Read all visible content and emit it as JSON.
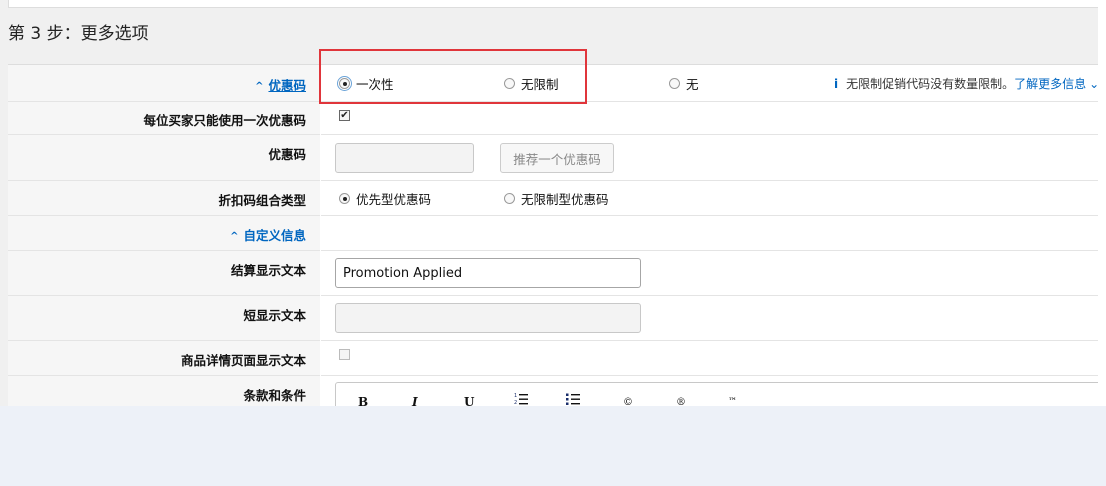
{
  "step_heading": "第 3 步：更多选项",
  "rows": {
    "promo_code_section": {
      "label": "优惠码",
      "options": [
        "一次性",
        "无限制",
        "无"
      ],
      "selected": "一次性"
    },
    "one_per_buyer": {
      "label": "每位买家只能使用一次优惠码",
      "checked": true
    },
    "promo_code_field": {
      "label": "优惠码",
      "value": "",
      "suggest_button": "推荐一个优惠码"
    },
    "combination_type": {
      "label": "折扣码组合类型",
      "options": [
        "优先型优惠码",
        "无限制型优惠码"
      ],
      "selected": "优先型优惠码"
    },
    "custom_info_section": {
      "label": "自定义信息"
    },
    "checkout_text": {
      "label": "结算显示文本",
      "value": "Promotion Applied"
    },
    "short_text": {
      "label": "短显示文本",
      "value": ""
    },
    "detail_page_text": {
      "label": "商品详情页面显示文本",
      "checked": false
    },
    "terms": {
      "label": "条款和条件"
    }
  },
  "info_note": {
    "text": "无限制促销代码没有数量限制。",
    "link": "了解更多信息",
    "link_caret": "⌄",
    "icon": "i"
  },
  "editor_toolbar": [
    "B",
    "I",
    "U",
    "ordered-list",
    "unordered-list",
    "©",
    "®",
    "™"
  ],
  "colors": {
    "link": "#0066c0",
    "highlight_box": "#e0353b",
    "page_bg": "#edf1f8"
  }
}
